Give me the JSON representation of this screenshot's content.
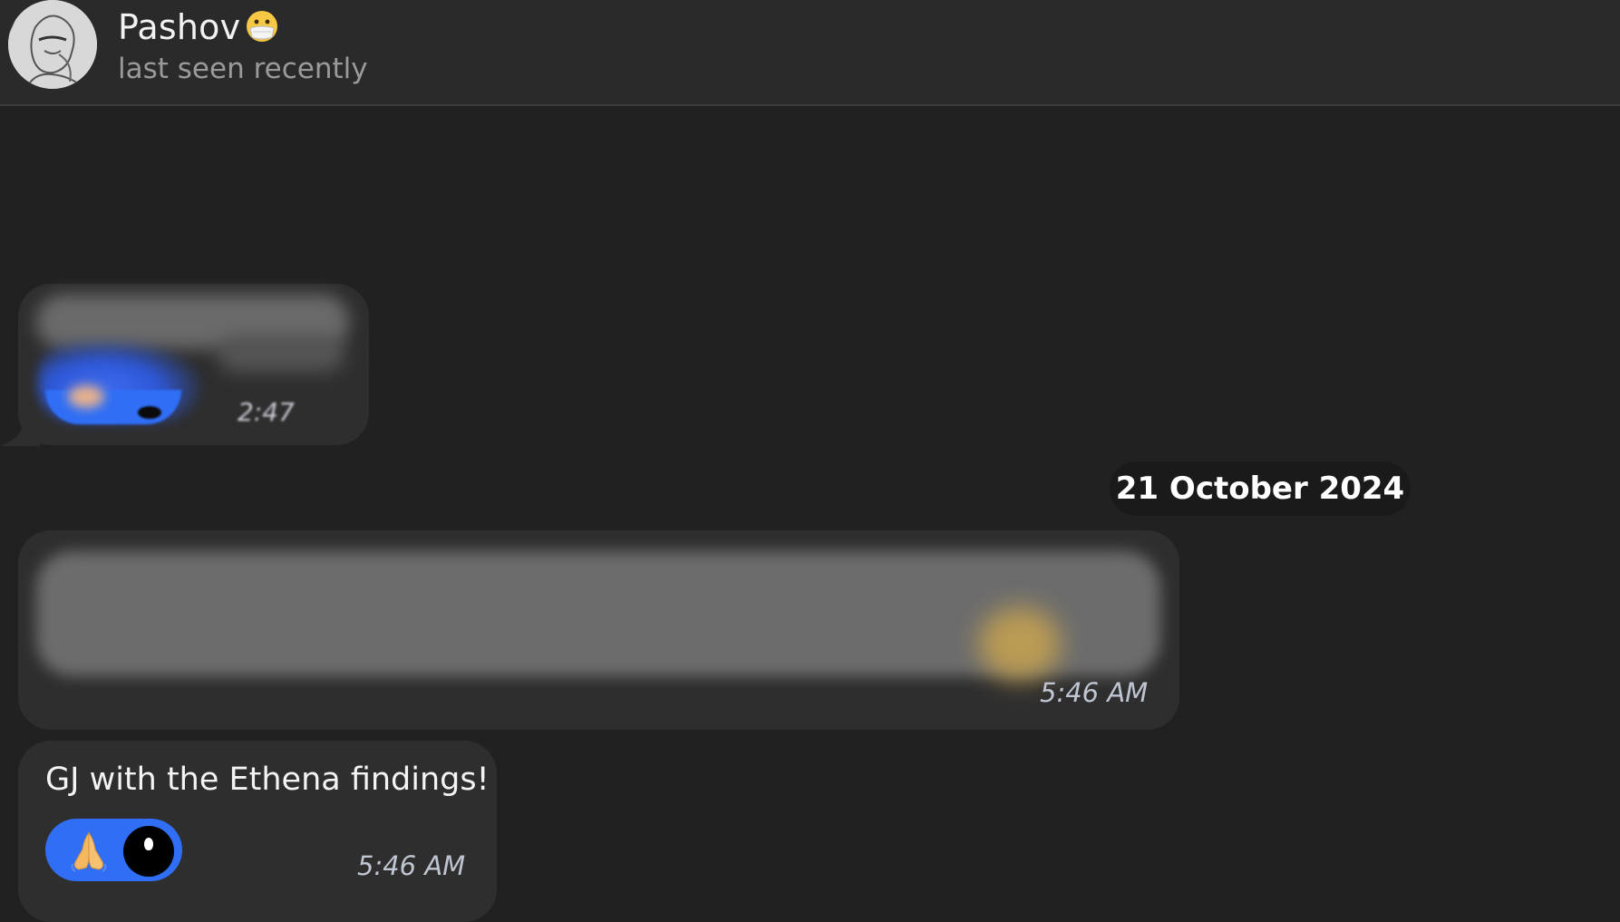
{
  "header": {
    "contact_name": "Pashov",
    "contact_status": "last seen recently",
    "name_emoji_icon": "face-with-mask-emoji",
    "avatar_icon": "sketch-portrait-avatar"
  },
  "messages": [
    {
      "content": "blurred-media",
      "time": "2:47 PM"
    },
    {
      "date_separator": "21 October 2024"
    },
    {
      "content": "blurred-media",
      "time": "5:46 AM"
    },
    {
      "text": "GJ with the Ethena findings!",
      "time": "5:46 AM",
      "reaction": {
        "emoji_icon": "folded-hands-emoji",
        "reactor_avatar_icon": "black-circle-avatar"
      }
    }
  ],
  "colors": {
    "background": "#212121",
    "header_bg": "#2a2a2a",
    "bubble_bg": "#2e2e2e",
    "reaction_accent": "#2f6ef5",
    "date_pill_bg": "#1a1a1a"
  }
}
